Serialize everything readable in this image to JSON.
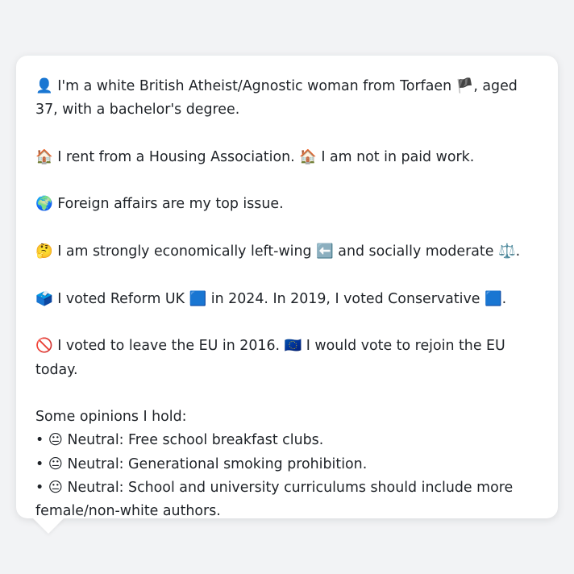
{
  "profile": {
    "identity": {
      "emoji": "👤",
      "text_before_flag": "I'm a white British Atheist/Agnostic woman from Torfaen",
      "flag": "🏴",
      "text_after_flag": ", aged 37, with a bachelor's degree."
    },
    "housing": {
      "emoji1": "🏠",
      "text1": "I rent from a Housing Association.",
      "emoji2": "🏠",
      "text2": "I am not in paid work."
    },
    "top_issue": {
      "emoji": "🌍",
      "text": "Foreign affairs are my top issue."
    },
    "ideology": {
      "emoji": "🤔",
      "text1": "I am strongly economically left-wing",
      "emoji2": "⬅️",
      "text2": "and socially moderate",
      "emoji3": "⚖️",
      "text3": "."
    },
    "votes": {
      "emoji": "🗳️",
      "text1": "I voted Reform UK",
      "party_icon1": "🟦",
      "text2": "in 2024. In 2019, I voted Conservative",
      "party_icon2": "🟦",
      "text3": "."
    },
    "brexit": {
      "emoji": "🚫",
      "text1": "I voted to leave the EU in 2016.",
      "emoji2": "🇪🇺",
      "text2": "I would vote to rejoin the EU today."
    },
    "opinions": {
      "title": "Some opinions I hold:",
      "bullet": "•",
      "items": [
        {
          "emoji": "😐",
          "stance": "Neutral:",
          "text": "Free school breakfast clubs."
        },
        {
          "emoji": "😐",
          "stance": "Neutral:",
          "text": "Generational smoking prohibition."
        },
        {
          "emoji": "😐",
          "stance": "Neutral:",
          "text": "School and university curriculums should include more female/non-white authors."
        }
      ]
    }
  },
  "colors": {
    "background": "#f2f3f5",
    "card": "#ffffff",
    "text": "#1f2328"
  }
}
